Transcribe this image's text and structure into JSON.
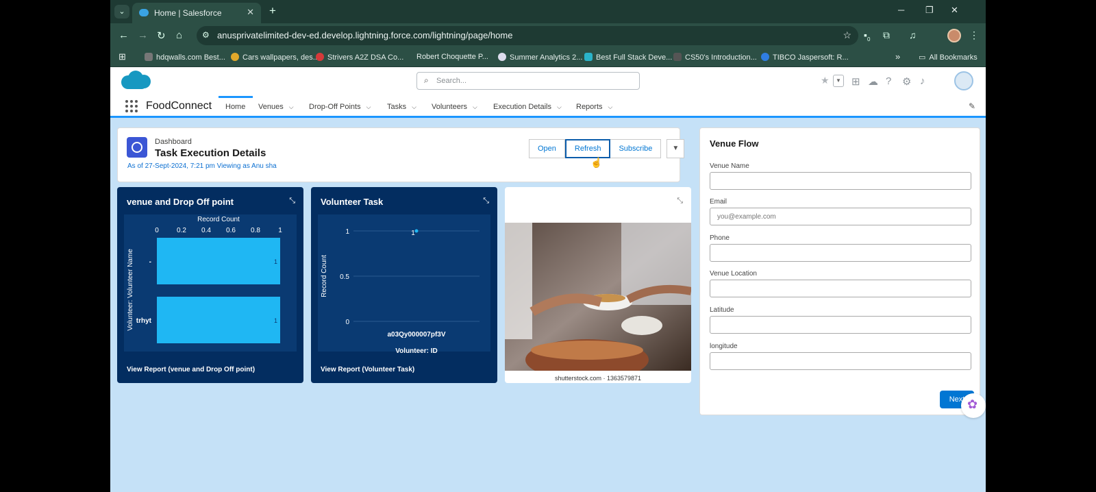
{
  "browser": {
    "tab_title": "Home | Salesforce",
    "tab_list_icon": "⌄",
    "tab_close": "✕",
    "new_tab": "+",
    "window_controls": [
      "─",
      "❐",
      "✕"
    ],
    "url": "anusprivatelimited-dev-ed.develop.lightning.force.com/lightning/page/home",
    "bookmarks": [
      "hdqwalls.com Best...",
      "Cars wallpapers, des...",
      "Strivers A2Z DSA Co...",
      "Robert Choquette P...",
      "Summer Analytics 2...",
      "Best Full Stack Deve...",
      "CS50's Introduction...",
      "TIBCO Jaspersoft: R..."
    ],
    "bookmarks_overflow": "»",
    "all_bookmarks": "All Bookmarks",
    "extension_badge": "0",
    "colors": {
      "chrome_dark": "#1e3a33",
      "chrome": "#2c4f45"
    }
  },
  "sf": {
    "search_placeholder": "Search...",
    "app_name": "FoodConnect",
    "nav": [
      "Home",
      "Venues",
      "Drop-Off Points",
      "Tasks",
      "Volunteers",
      "Execution Details",
      "Reports"
    ],
    "colors": {
      "brand": "#0176d3",
      "nav_underline": "#1b96ff",
      "background": "#c5e1f7"
    }
  },
  "dashboard": {
    "type_label": "Dashboard",
    "title": "Task Execution Details",
    "as_of": "As of 27-Sept-2024, 7:21 pm Viewing as Anu sha",
    "buttons": [
      "Open",
      "Refresh",
      "Subscribe"
    ]
  },
  "widget1": {
    "title": "venue and Drop Off point",
    "view_report": "View Report (venue and Drop Off point)"
  },
  "widget2": {
    "title": "Volunteer Task",
    "view_report": "View Report (Volunteer Task)"
  },
  "widget3": {
    "credit": "shutterstock.com · 1363579871"
  },
  "chart_data": [
    {
      "type": "bar",
      "orientation": "horizontal",
      "title": "",
      "xlabel": "Record Count",
      "ylabel": "Volunteer: Volunteer Name",
      "xlim": [
        0,
        1
      ],
      "xticks": [
        "0",
        "0.2",
        "0.4",
        "0.6",
        "0.8",
        "1"
      ],
      "categories": [
        "-",
        "trhyt"
      ],
      "values": [
        1,
        1
      ],
      "data_labels": [
        "1",
        "1"
      ],
      "color": "#1fb7f3"
    },
    {
      "type": "scatter",
      "title": "",
      "xlabel": "Volunteer: ID",
      "ylabel": "Record Count",
      "ylim": [
        0,
        1
      ],
      "yticks": [
        "0",
        "0.5",
        "1"
      ],
      "categories": [
        "a03Qy000007pf3V"
      ],
      "values": [
        1
      ],
      "data_labels": [
        "1"
      ],
      "color": "#1fb7f3"
    }
  ],
  "flow": {
    "title": "Venue Flow",
    "fields": [
      {
        "label": "Venue Name",
        "value": "",
        "placeholder": ""
      },
      {
        "label": "Email",
        "value": "",
        "placeholder": "you@example.com"
      },
      {
        "label": "Phone",
        "value": "",
        "placeholder": ""
      },
      {
        "label": "Venue Location",
        "value": "",
        "placeholder": ""
      },
      {
        "label": "Latitude",
        "value": "",
        "placeholder": ""
      },
      {
        "label": "longitude",
        "value": "",
        "placeholder": ""
      }
    ],
    "next": "Next"
  }
}
